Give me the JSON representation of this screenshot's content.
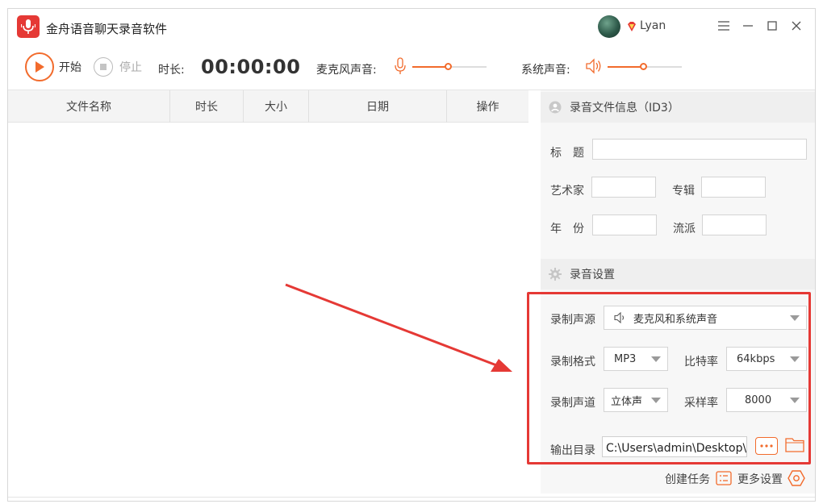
{
  "app": {
    "title": "金舟语音聊天录音软件"
  },
  "user": {
    "name": "Lyan"
  },
  "toolbar": {
    "start_label": "开始",
    "stop_label": "停止",
    "duration_label": "时长:",
    "duration_value": "00:00:00",
    "mic_label": "麦克风声音:",
    "mic_level": 0.48,
    "system_label": "系统声音:",
    "system_level": 0.48
  },
  "table": {
    "columns": [
      "文件名称",
      "时长",
      "大小",
      "日期",
      "操作"
    ]
  },
  "id3": {
    "section_title": "录音文件信息（ID3）",
    "title_label": "标　题",
    "title_value": "",
    "artist_label": "艺术家",
    "artist_value": "",
    "album_label": "专辑",
    "album_value": "",
    "year_label": "年　份",
    "year_value": "",
    "genre_label": "流派",
    "genre_value": ""
  },
  "settings": {
    "section_title": "录音设置",
    "source_label": "录制声源",
    "source_value": "麦克风和系统声音",
    "format_label": "录制格式",
    "format_value": "MP3",
    "bitrate_label": "比特率",
    "bitrate_value": "64kbps",
    "channel_label": "录制声道",
    "channel_value": "立体声",
    "samplerate_label": "采样率",
    "samplerate_value": "8000",
    "output_label": "输出目录",
    "output_value": "C:\\Users\\admin\\Desktop\\金"
  },
  "footer": {
    "create_task_label": "创建任务",
    "more_settings_label": "更多设置"
  },
  "colors": {
    "accent": "#f26b2c",
    "highlight": "#e53935",
    "brand": "#e53935"
  }
}
